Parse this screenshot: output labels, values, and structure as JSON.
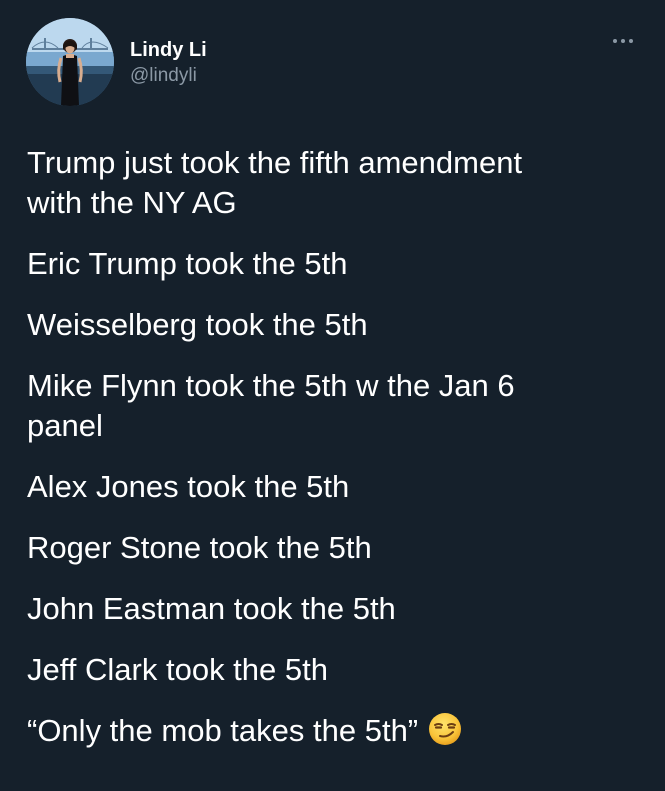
{
  "user": {
    "display_name": "Lindy Li",
    "handle": "@lindyli"
  },
  "menu": {
    "icon": "more-icon"
  },
  "tweet": {
    "lines": [
      "Trump just took the fifth amendment",
      "with the NY AG",
      "Eric Trump took the 5th",
      "Weisselberg took the 5th",
      "Mike Flynn took the 5th w the Jan 6",
      "panel",
      "Alex Jones took the 5th",
      "Roger Stone took the 5th",
      "John Eastman took the 5th",
      "Jeff Clark took the 5th",
      "“Only the mob takes the 5th”"
    ],
    "emoji": "smirking-face-emoji"
  },
  "colors": {
    "background": "#15202b",
    "text": "#ffffff",
    "secondary_text": "#8b98a5"
  }
}
